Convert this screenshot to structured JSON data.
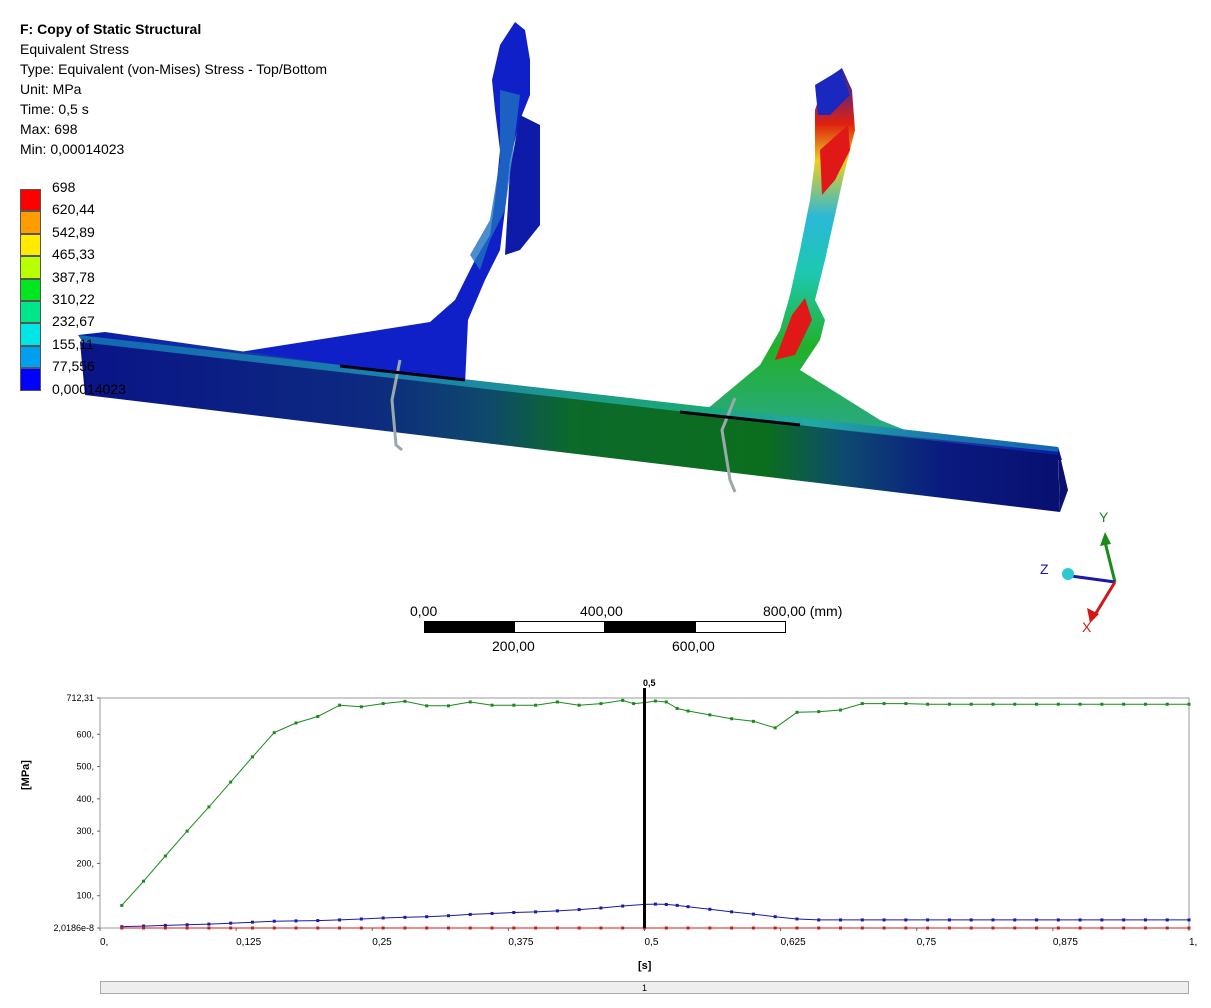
{
  "info": {
    "title": "F: Copy of Static Structural",
    "result": "Equivalent Stress",
    "type": "Type: Equivalent (von-Mises) Stress - Top/Bottom",
    "unit": "Unit: MPa",
    "time": "Time: 0,5 s",
    "max": "Max: 698",
    "min": "Min: 0,00014023"
  },
  "legend": {
    "labels": [
      "698",
      "620,44",
      "542,89",
      "465,33",
      "387,78",
      "310,22",
      "232,67",
      "155,11",
      "77,556",
      "0,00014023"
    ],
    "colors": [
      "#ff0000",
      "#ff9d00",
      "#ffea00",
      "#b8ff00",
      "#00e61f",
      "#00e68a",
      "#00e6e6",
      "#00a0ee",
      "#0000ff"
    ]
  },
  "scale_bar": {
    "top_labels": [
      "0,00",
      "400,00",
      "800,00 (mm)"
    ],
    "bottom_labels": [
      "200,00",
      "600,00"
    ]
  },
  "triad": {
    "x": "X",
    "y": "Y",
    "z": "Z"
  },
  "chart_data": {
    "type": "line",
    "xlabel": "[s]",
    "ylabel": "[MPa]",
    "xlim": [
      0,
      1
    ],
    "ylim": [
      2.0186e-08,
      712.31
    ],
    "x_tick_labels": [
      "0,",
      "0,125",
      "0,25",
      "0,375",
      "0,5",
      "0,625",
      "0,75",
      "0,875",
      "1,"
    ],
    "y_tick_labels": [
      "2,0186e-8",
      "100,",
      "200,",
      "300,",
      "400,",
      "500,",
      "600,",
      "712,31"
    ],
    "cursor": {
      "x": 0.5,
      "label": "0,5"
    },
    "series": [
      {
        "color": "#1a8a1a",
        "points": [
          [
            0.02,
            70
          ],
          [
            0.04,
            145
          ],
          [
            0.06,
            223
          ],
          [
            0.08,
            300
          ],
          [
            0.1,
            375
          ],
          [
            0.12,
            452
          ],
          [
            0.14,
            530
          ],
          [
            0.16,
            605
          ],
          [
            0.18,
            635
          ],
          [
            0.2,
            655
          ],
          [
            0.22,
            690
          ],
          [
            0.24,
            685
          ],
          [
            0.26,
            695
          ],
          [
            0.28,
            702
          ],
          [
            0.3,
            688
          ],
          [
            0.32,
            688
          ],
          [
            0.34,
            700
          ],
          [
            0.36,
            690
          ],
          [
            0.38,
            690
          ],
          [
            0.4,
            690
          ],
          [
            0.42,
            700
          ],
          [
            0.44,
            690
          ],
          [
            0.46,
            695
          ],
          [
            0.48,
            705
          ],
          [
            0.49,
            695
          ],
          [
            0.5,
            698
          ],
          [
            0.51,
            703
          ],
          [
            0.52,
            700
          ],
          [
            0.53,
            680
          ],
          [
            0.54,
            672
          ],
          [
            0.56,
            660
          ],
          [
            0.58,
            648
          ],
          [
            0.6,
            640
          ],
          [
            0.62,
            620
          ],
          [
            0.64,
            668
          ],
          [
            0.66,
            670
          ],
          [
            0.68,
            675
          ],
          [
            0.7,
            695
          ],
          [
            0.72,
            695
          ],
          [
            0.74,
            695
          ],
          [
            0.76,
            693
          ],
          [
            0.78,
            693
          ],
          [
            0.8,
            693
          ],
          [
            0.82,
            693
          ],
          [
            0.84,
            693
          ],
          [
            0.86,
            693
          ],
          [
            0.88,
            693
          ],
          [
            0.9,
            693
          ],
          [
            0.92,
            693
          ],
          [
            0.94,
            693
          ],
          [
            0.96,
            693
          ],
          [
            0.98,
            693
          ],
          [
            1.0,
            693
          ]
        ]
      },
      {
        "color": "#1a1aa8",
        "points": [
          [
            0.02,
            4
          ],
          [
            0.04,
            6
          ],
          [
            0.06,
            8
          ],
          [
            0.08,
            10
          ],
          [
            0.1,
            12
          ],
          [
            0.12,
            15
          ],
          [
            0.14,
            18
          ],
          [
            0.16,
            21
          ],
          [
            0.18,
            22
          ],
          [
            0.2,
            23
          ],
          [
            0.22,
            25
          ],
          [
            0.24,
            28
          ],
          [
            0.26,
            31
          ],
          [
            0.28,
            33
          ],
          [
            0.3,
            35
          ],
          [
            0.32,
            38
          ],
          [
            0.34,
            42
          ],
          [
            0.36,
            45
          ],
          [
            0.38,
            48
          ],
          [
            0.4,
            50
          ],
          [
            0.42,
            53
          ],
          [
            0.44,
            57
          ],
          [
            0.46,
            62
          ],
          [
            0.48,
            68
          ],
          [
            0.5,
            73
          ],
          [
            0.51,
            74
          ],
          [
            0.52,
            73
          ],
          [
            0.53,
            70
          ],
          [
            0.54,
            66
          ],
          [
            0.56,
            58
          ],
          [
            0.58,
            50
          ],
          [
            0.6,
            43
          ],
          [
            0.62,
            35
          ],
          [
            0.64,
            28
          ],
          [
            0.66,
            25
          ],
          [
            0.68,
            25
          ],
          [
            0.7,
            25
          ],
          [
            0.72,
            25
          ],
          [
            0.74,
            25
          ],
          [
            0.76,
            25
          ],
          [
            0.78,
            25
          ],
          [
            0.8,
            25
          ],
          [
            0.82,
            25
          ],
          [
            0.84,
            25
          ],
          [
            0.86,
            25
          ],
          [
            0.88,
            25
          ],
          [
            0.9,
            25
          ],
          [
            0.92,
            25
          ],
          [
            0.94,
            25
          ],
          [
            0.96,
            25
          ],
          [
            0.98,
            25
          ],
          [
            1.0,
            25
          ]
        ]
      },
      {
        "color": "#c81e1e",
        "points": [
          [
            0.02,
            0
          ],
          [
            0.04,
            0
          ],
          [
            0.06,
            0
          ],
          [
            0.08,
            0
          ],
          [
            0.1,
            0
          ],
          [
            0.12,
            0
          ],
          [
            0.14,
            0
          ],
          [
            0.16,
            0
          ],
          [
            0.18,
            0
          ],
          [
            0.2,
            0
          ],
          [
            0.22,
            0
          ],
          [
            0.24,
            0
          ],
          [
            0.26,
            0
          ],
          [
            0.28,
            0
          ],
          [
            0.3,
            0
          ],
          [
            0.32,
            0
          ],
          [
            0.34,
            0
          ],
          [
            0.36,
            0
          ],
          [
            0.38,
            0
          ],
          [
            0.4,
            0
          ],
          [
            0.42,
            0
          ],
          [
            0.44,
            0
          ],
          [
            0.46,
            0
          ],
          [
            0.48,
            0
          ],
          [
            0.5,
            0
          ],
          [
            0.52,
            0
          ],
          [
            0.54,
            0
          ],
          [
            0.56,
            0
          ],
          [
            0.58,
            0
          ],
          [
            0.6,
            0
          ],
          [
            0.62,
            0
          ],
          [
            0.64,
            0
          ],
          [
            0.66,
            0
          ],
          [
            0.68,
            0
          ],
          [
            0.7,
            0
          ],
          [
            0.72,
            0
          ],
          [
            0.74,
            0
          ],
          [
            0.76,
            0
          ],
          [
            0.78,
            0
          ],
          [
            0.8,
            0
          ],
          [
            0.82,
            0
          ],
          [
            0.84,
            0
          ],
          [
            0.86,
            0
          ],
          [
            0.88,
            0
          ],
          [
            0.9,
            0
          ],
          [
            0.92,
            0
          ],
          [
            0.94,
            0
          ],
          [
            0.96,
            0
          ],
          [
            0.98,
            0
          ],
          [
            1.0,
            0
          ]
        ]
      }
    ]
  },
  "graph_footer": {
    "label": "1"
  }
}
